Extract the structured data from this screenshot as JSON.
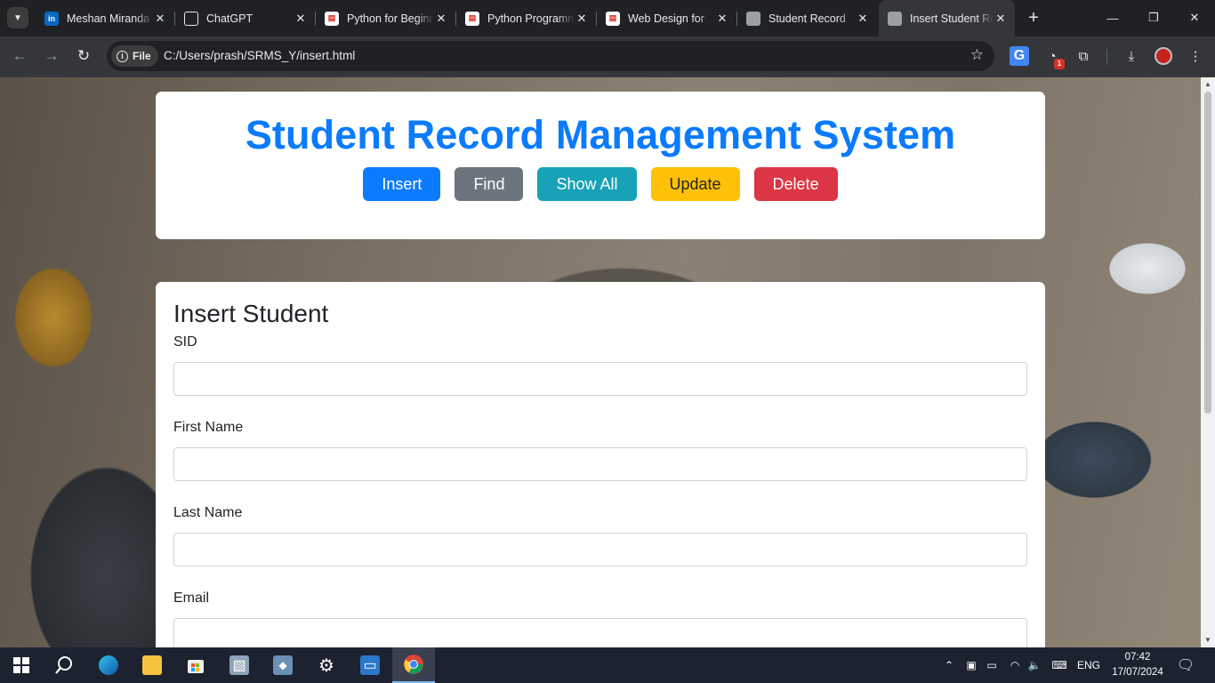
{
  "browser": {
    "tabs": [
      {
        "title": "Meshan Miranda",
        "favicon": "linkedin-icon",
        "active": false
      },
      {
        "title": "ChatGPT",
        "favicon": "chatgpt-icon",
        "active": false
      },
      {
        "title": "Python for Beginners",
        "favicon": "pdf-icon",
        "active": false
      },
      {
        "title": "Python Programming",
        "favicon": "pdf-icon",
        "active": false
      },
      {
        "title": "Web Design for",
        "favicon": "pdf-icon",
        "active": false
      },
      {
        "title": "Student Record",
        "favicon": "globe-icon",
        "active": false
      },
      {
        "title": "Insert Student Record",
        "favicon": "globe-icon",
        "active": true
      }
    ],
    "chip_label": "File",
    "url": "C:/Users/prash/SRMS_Y/insert.html",
    "extension_badge": "1"
  },
  "page": {
    "title": "Student Record Management System",
    "nav": [
      {
        "label": "Insert",
        "style": "primary"
      },
      {
        "label": "Find",
        "style": "secondary"
      },
      {
        "label": "Show All",
        "style": "info"
      },
      {
        "label": "Update",
        "style": "warning"
      },
      {
        "label": "Delete",
        "style": "danger"
      }
    ],
    "form": {
      "heading": "Insert Student",
      "fields": [
        {
          "label": "SID",
          "value": ""
        },
        {
          "label": "First Name",
          "value": ""
        },
        {
          "label": "Last Name",
          "value": ""
        },
        {
          "label": "Email",
          "value": ""
        }
      ]
    }
  },
  "taskbar": {
    "language": "ENG",
    "time": "07:42",
    "date": "17/07/2024"
  },
  "colors": {
    "title_blue": "#0a7bfd",
    "primary": "#0d7bfd",
    "secondary": "#6c757d",
    "info": "#17a2b8",
    "warning": "#ffc107",
    "danger": "#dc3545"
  }
}
